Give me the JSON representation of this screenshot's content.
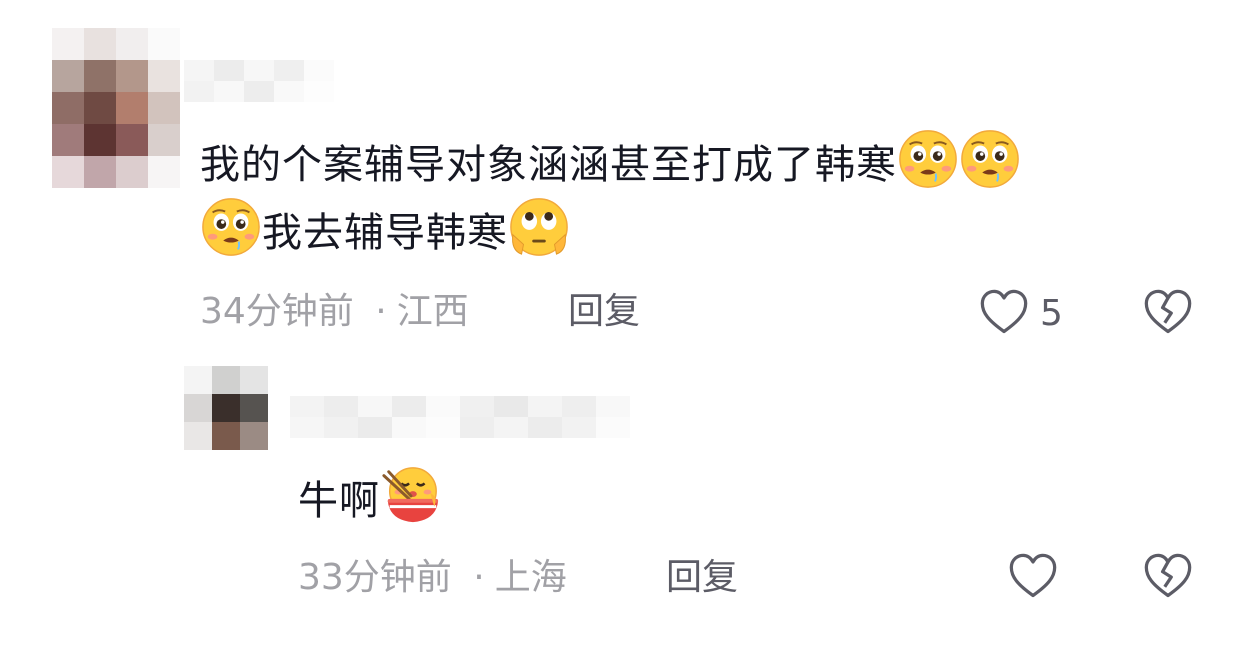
{
  "comments": [
    {
      "text_part1": "我的个案辅导对象涵涵甚至打成了韩寒",
      "text_part2": "我去辅导韩寒",
      "emojis": [
        "pleading-drool-emoji",
        "pleading-drool-emoji",
        "pleading-drool-emoji",
        "eye-roll-emoji"
      ],
      "time": "34分钟前",
      "separator": "·",
      "location": "江西",
      "reply_label": "回复",
      "like_count": "5",
      "icons": [
        "heart-outline-icon",
        "broken-heart-icon"
      ]
    },
    {
      "text_main": "牛啊",
      "emojis": [
        "eating-noodles-emoji"
      ],
      "time": "33分钟前",
      "separator": "·",
      "location": "上海",
      "reply_label": "回复",
      "icons": [
        "heart-outline-icon",
        "broken-heart-icon"
      ]
    }
  ],
  "colors": {
    "text": "#161823",
    "meta": "#a1a1a6",
    "action": "#5c5c66",
    "emoji_face": "#ffcd3c"
  }
}
